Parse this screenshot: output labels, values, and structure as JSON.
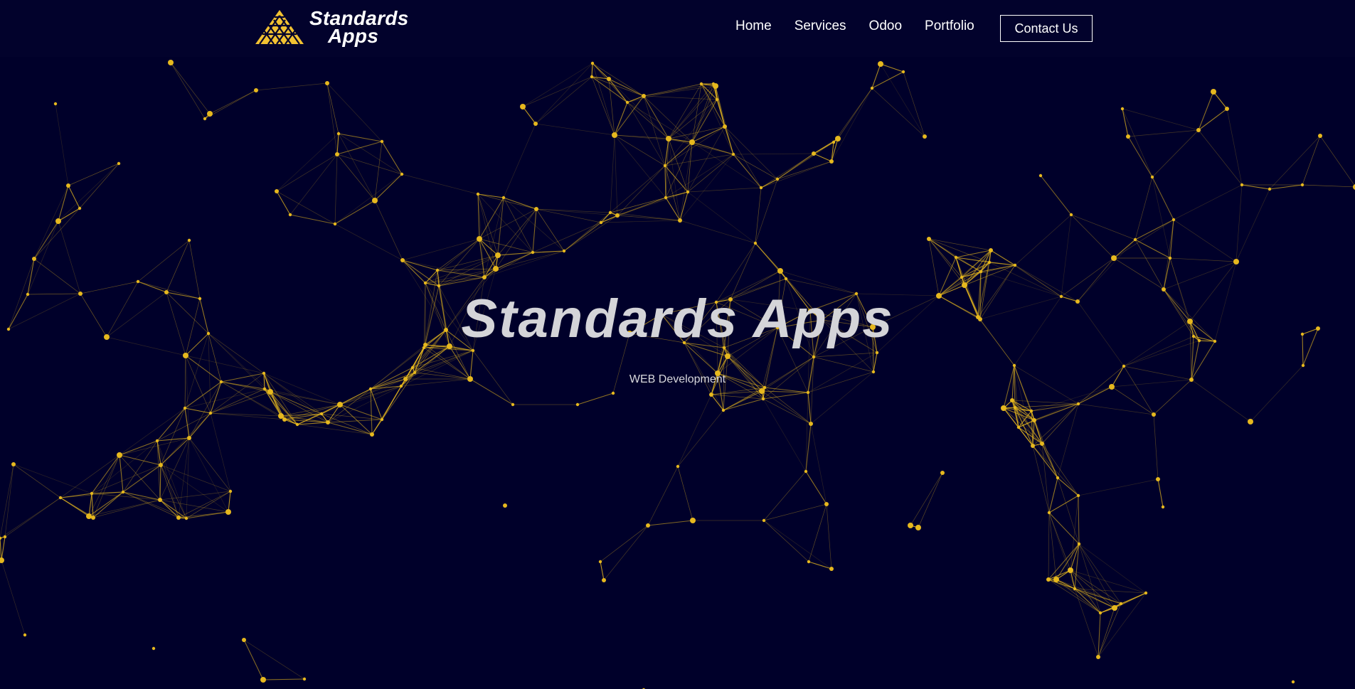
{
  "logo": {
    "line1": "Standards",
    "line2": "Apps",
    "accent_color": "#f2c232"
  },
  "nav": {
    "items": [
      {
        "label": "Home"
      },
      {
        "label": "Services"
      },
      {
        "label": "Odoo"
      },
      {
        "label": "Portfolio"
      }
    ],
    "contact_label": "Contact Us"
  },
  "hero": {
    "title": "Standards Apps",
    "subtitle": "WEB Development"
  },
  "colors": {
    "background": "#00002a",
    "network": "#e6b81e",
    "text": "#ffffff"
  }
}
